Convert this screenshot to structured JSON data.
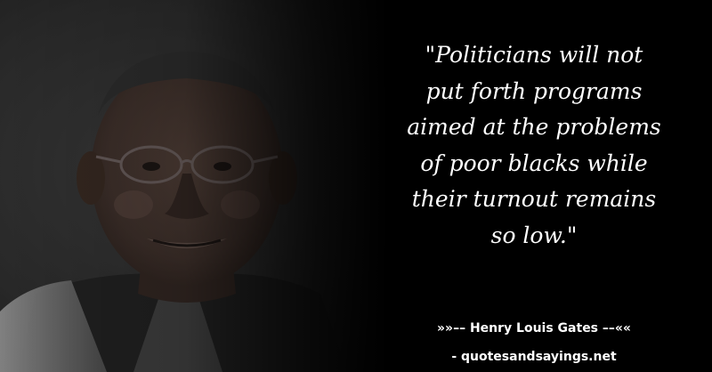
{
  "quote": {
    "lines": [
      "\"Politicians will not",
      "put forth programs",
      "aimed at the problems",
      "of poor blacks while",
      "their turnout remains",
      "so low.\""
    ]
  },
  "author": {
    "text": "»»–– Henry Louis Gates ––««"
  },
  "footer": {
    "site": "- quotesandsayings.net"
  },
  "colors": {
    "background": "#000000",
    "text": "#ffffff"
  }
}
